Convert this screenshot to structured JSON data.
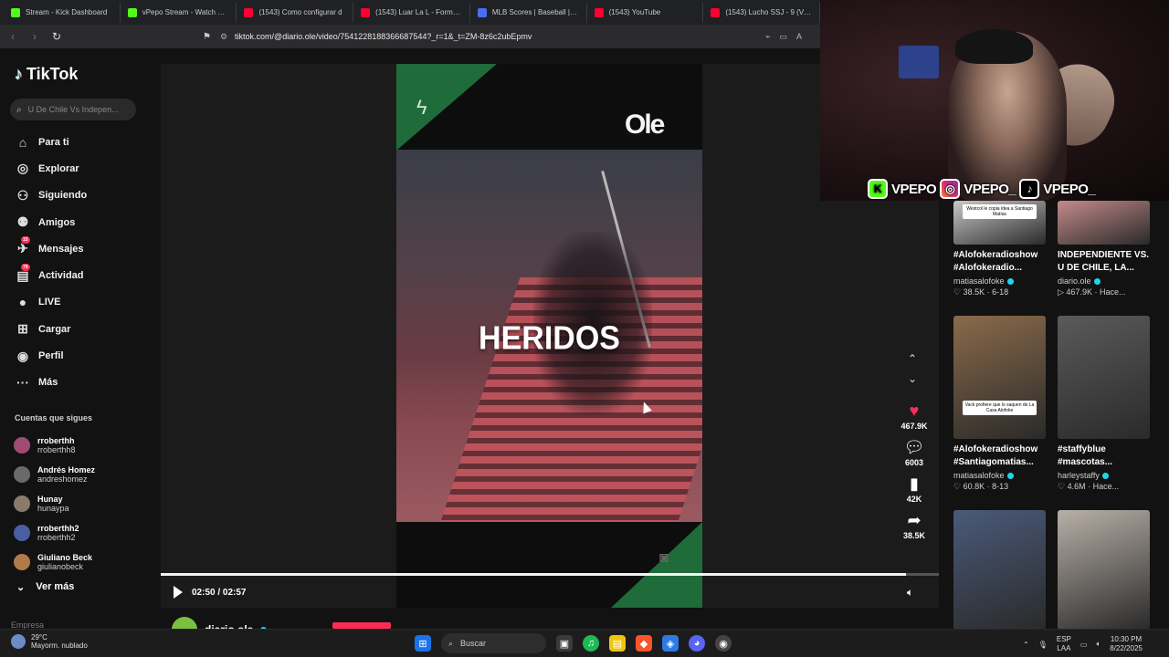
{
  "browser": {
    "tabs": [
      {
        "title": "Stream - Kick Dashboard",
        "color": "#53fc18"
      },
      {
        "title": "vPepo Stream - Watch Live",
        "color": "#53fc18"
      },
      {
        "title": "(1543) Como configurar d",
        "color": "#ff0033"
      },
      {
        "title": "(1543) Luar La L - Formule",
        "color": "#ff0033"
      },
      {
        "title": "MLB Scores | Baseball | Sc",
        "color": "#4a6cf7"
      },
      {
        "title": "(1543) YouTube",
        "color": "#ff0033"
      },
      {
        "title": "(1543) Lucho SSJ - 9 (Vide",
        "color": "#ff0033"
      }
    ],
    "url": "tiktok.com/@diario.ole/video/7541228188366687544?_r=1&_t=ZM-8z6c2ubEpmv"
  },
  "sidebar": {
    "logo": "TikTok",
    "search_placeholder": "U De Chile Vs Indepen...",
    "nav": [
      {
        "label": "Para ti",
        "icon": "⌂"
      },
      {
        "label": "Explorar",
        "icon": "◎"
      },
      {
        "label": "Siguiendo",
        "icon": "⚇"
      },
      {
        "label": "Amigos",
        "icon": "⚉"
      },
      {
        "label": "Mensajes",
        "icon": "✈",
        "badge": "15"
      },
      {
        "label": "Actividad",
        "icon": "▤",
        "badge": "79"
      },
      {
        "label": "LIVE",
        "icon": "●"
      },
      {
        "label": "Cargar",
        "icon": "⊞"
      },
      {
        "label": "Perfil",
        "icon": "◉"
      },
      {
        "label": "Más",
        "icon": "···"
      }
    ],
    "following_title": "Cuentas que sigues",
    "following": [
      {
        "name": "rroberthh",
        "handle": "rroberthh8",
        "color": "#a24b72"
      },
      {
        "name": "Andrés Homez",
        "handle": "andreshomez",
        "color": "#6a6a6a"
      },
      {
        "name": "Hunay",
        "handle": "hunaypa",
        "color": "#8a7a6a"
      },
      {
        "name": "rroberthh2",
        "handle": "rroberthh2",
        "color": "#4a5fa2"
      },
      {
        "name": "Giuliano Beck",
        "handle": "giulianobeck",
        "color": "#b07a4a"
      }
    ],
    "see_more": "Ver más",
    "footer": "Empresa"
  },
  "video": {
    "brand": "Ole",
    "overlay_text": "HERIDOS",
    "time": "02:50 / 02:57",
    "progress": 0.958,
    "author": "diario.ole",
    "likes": "467.9K",
    "comments": "6003",
    "saves": "42K",
    "shares": "38.5K"
  },
  "grid": [
    {
      "caption1": "#Alofokeradioshow",
      "caption2": "#Alofokeradio...",
      "user": "matiasalofoke",
      "stats": "♡ 38.5K · 6-18",
      "thumb": "#c8c8c8",
      "overlay": "Westcol le copia idea a Santiago Matías",
      "h": 48
    },
    {
      "caption1": "INDEPENDIENTE VS.",
      "caption2": "U DE CHILE, LA...",
      "user": "diario.ole",
      "stats": "▷ 467.9K · Hace...",
      "thumb": "#c48a8a",
      "overlay": "",
      "h": 48
    },
    {
      "caption1": "#Alofokeradioshow",
      "caption2": "#Santiagomatias...",
      "user": "matiasalofoke",
      "stats": "♡ 60.8K · 8-13",
      "thumb": "#8a6a4a",
      "overlay": "Vack profiere que lo saquen de La Casa Alofoke",
      "h": 135
    },
    {
      "caption1": "#staffyblue",
      "caption2": "#mascotas...",
      "user": "harleystaffy",
      "stats": "♡ 4.6M · Hace...",
      "thumb": "#5a5a5a",
      "overlay": "",
      "h": 135
    },
    {
      "caption1": "",
      "caption2": "",
      "user": "",
      "stats": "",
      "thumb": "#4a5a7a",
      "overlay": "",
      "h": 131
    },
    {
      "caption1": "",
      "caption2": "",
      "user": "",
      "stats": "",
      "thumb": "#b8b0a8",
      "overlay": "",
      "h": 131
    }
  ],
  "stream": {
    "handles": [
      "VPEPO",
      "VPEPO_",
      "VPEPO_"
    ]
  },
  "taskbar": {
    "temp": "29°C",
    "weather": "Mayorm. nublado",
    "search": "Buscar",
    "lang1": "ESP",
    "lang2": "LAA",
    "time": "10:30 PM",
    "date": "8/22/2025"
  }
}
